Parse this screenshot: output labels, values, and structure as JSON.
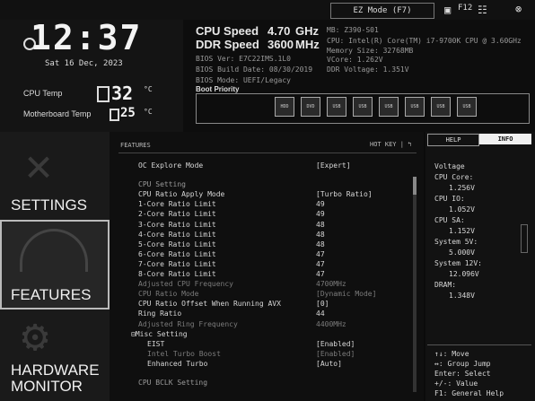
{
  "topbar": {
    "ez_mode": "EZ Mode (F7)",
    "f12": "F12"
  },
  "clock": {
    "time": "12:37",
    "date": "Sat  16 Dec, 2023"
  },
  "temps": {
    "cpu_label": "CPU Temp",
    "cpu_value": "32",
    "cpu_unit": "°C",
    "mb_label": "Motherboard Temp",
    "mb_value": "25",
    "mb_unit": "°C"
  },
  "stats": {
    "cpu_speed_label": "CPU Speed",
    "cpu_speed": "4.70",
    "cpu_speed_unit": "GHz",
    "ddr_speed_label": "DDR Speed",
    "ddr_speed": "3600",
    "ddr_speed_unit": "MHz"
  },
  "sysinfo": {
    "bios_ver": "BIOS Ver: E7C22IMS.1L0",
    "bios_date": "BIOS Build Date: 08/30/2019",
    "bios_mode": "BIOS Mode: UEFI/Legacy",
    "boot_priority": "Boot Priority",
    "mb": "MB: Z390-S01",
    "cpu": "CPU: Intel(R) Core(TM) i7-9700K CPU @ 3.60GHz",
    "mem": "Memory Size: 32768MB",
    "vcore": "VCore: 1.262V",
    "ddr_volt": "DDR Voltage: 1.351V"
  },
  "boot_devices": [
    "HDD",
    "DVD",
    "USB",
    "USB",
    "USB",
    "USB",
    "USB",
    "USB"
  ],
  "nav": {
    "settings": "SETTINGS",
    "features": "FEATURES",
    "hw1": "HARDWARE",
    "hw2": "MONITOR"
  },
  "content": {
    "section_title": "FEATURES",
    "hotkey": "HOT KEY | ↰",
    "rows": [
      {
        "label": "OC Explore Mode",
        "value": "[Expert]",
        "style": ""
      },
      {
        "label": "CPU Setting",
        "value": "",
        "style": "head"
      },
      {
        "label": "CPU Ratio Apply Mode",
        "value": "[Turbo Ratio]",
        "style": ""
      },
      {
        "label": "1-Core Ratio Limit",
        "value": "49",
        "style": ""
      },
      {
        "label": "2-Core Ratio Limit",
        "value": "49",
        "style": ""
      },
      {
        "label": "3-Core Ratio Limit",
        "value": "48",
        "style": ""
      },
      {
        "label": "4-Core Ratio Limit",
        "value": "48",
        "style": ""
      },
      {
        "label": "5-Core Ratio Limit",
        "value": "48",
        "style": ""
      },
      {
        "label": "6-Core Ratio Limit",
        "value": "47",
        "style": ""
      },
      {
        "label": "7-Core Ratio Limit",
        "value": "47",
        "style": ""
      },
      {
        "label": "8-Core Ratio Limit",
        "value": "47",
        "style": ""
      },
      {
        "label": "Adjusted CPU Frequency",
        "value": "4700MHz",
        "style": "dim"
      },
      {
        "label": "CPU Ratio Mode",
        "value": "[Dynamic Mode]",
        "style": "dim"
      },
      {
        "label": "CPU Ratio Offset When Running AVX",
        "value": "[0]",
        "style": ""
      },
      {
        "label": "Ring Ratio",
        "value": "44",
        "style": ""
      },
      {
        "label": "Adjusted Ring Frequency",
        "value": "4400MHz",
        "style": "dim"
      },
      {
        "label": "⊟Misc Setting",
        "value": "",
        "style": "misc"
      },
      {
        "label": "EIST",
        "value": "[Enabled]",
        "style": "indent"
      },
      {
        "label": "Intel Turbo Boost",
        "value": "[Enabled]",
        "style": "indent dim"
      },
      {
        "label": "Enhanced Turbo",
        "value": "[Auto]",
        "style": "indent"
      },
      {
        "label": "CPU BCLK Setting",
        "value": "",
        "style": "head"
      }
    ]
  },
  "right_panel": {
    "tab_help": "HELP",
    "tab_info": "INFO",
    "info_lines": [
      "Voltage",
      "CPU Core:",
      "1.256V",
      "CPU IO:",
      "1.052V",
      "CPU SA:",
      "1.152V",
      "System 5V:",
      "5.000V",
      "System 12V:",
      "12.096V",
      "DRAM:",
      "1.348V"
    ],
    "help_lines": [
      "↑↓: Move",
      "↔: Group Jump",
      "Enter: Select",
      "+/-: Value",
      "F1: General Help"
    ]
  }
}
